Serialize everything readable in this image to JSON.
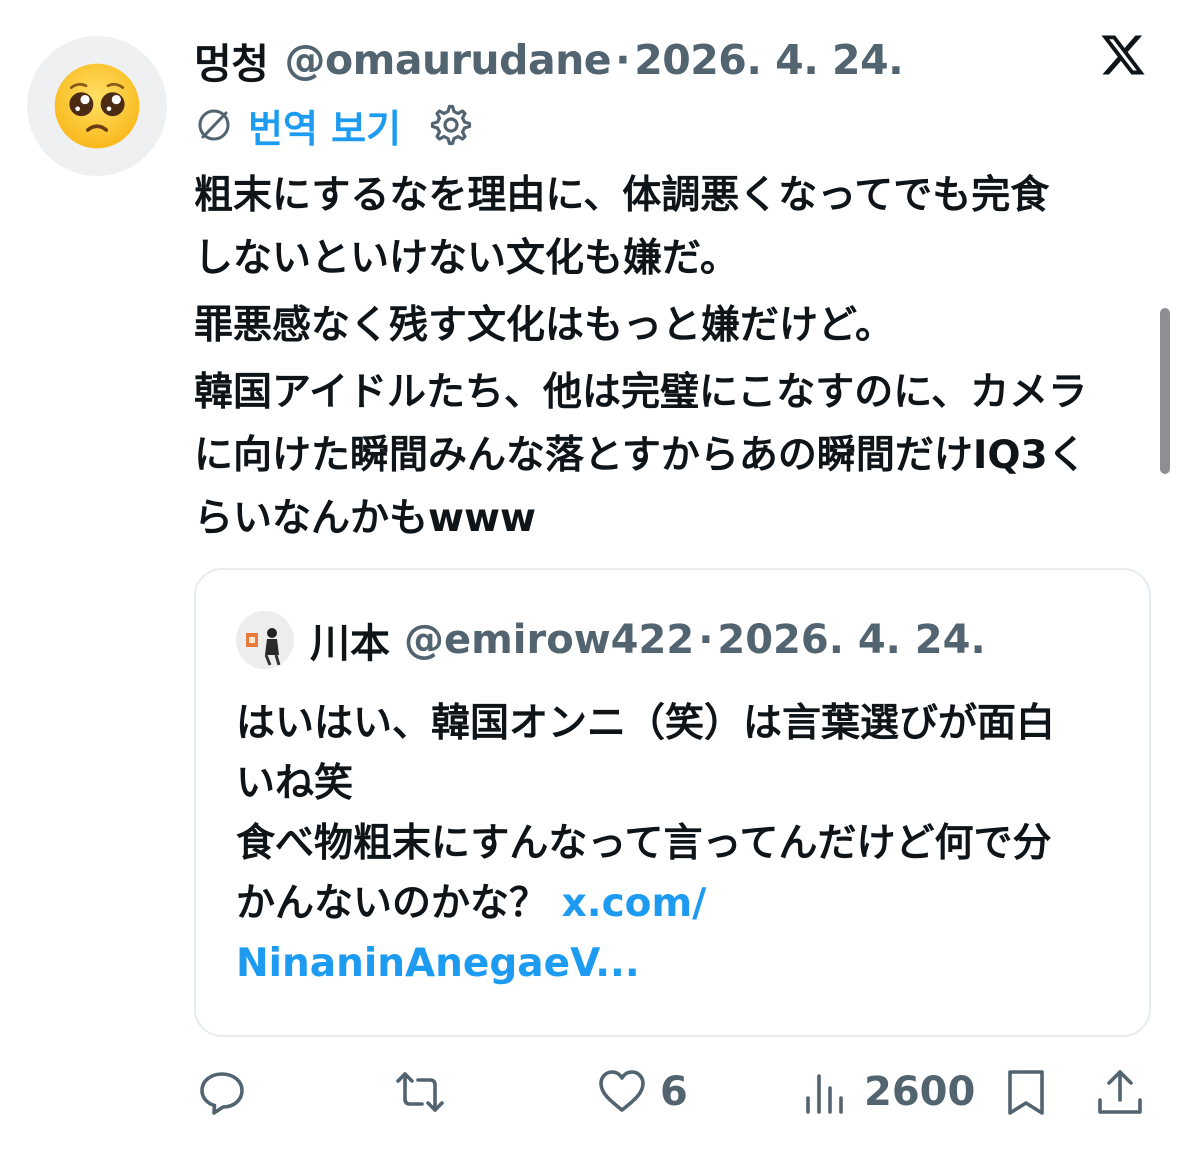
{
  "tweet": {
    "display_name": "멍청",
    "handle": "@omaurudane",
    "separator": "·",
    "date": "2026. 4. 24.",
    "translate_label": "번역 보기",
    "body_lines": [
      "粗末にするなを理由に、体調悪くなってでも完食",
      "しないといけない文化も嫌だ。",
      "罪悪感なく残す文化はもっと嫌だけど。",
      "韓国アイドルたち、他は完璧にこなすのに、カメラ",
      "に向けた瞬間みんな落とすからあの瞬間だけIQ3く",
      "らいなんかもwww"
    ]
  },
  "quote": {
    "display_name": "川本",
    "handle": "@emirow422",
    "separator": "·",
    "date": "2026. 4. 24.",
    "body_lines": [
      "はいはい、韓国オンニ（笑）は言葉選びが面白",
      "いね笑",
      "食べ物粗末にすんなって言ってんだけど何で分",
      "かんないのかな？"
    ],
    "link_part1": "x.com/",
    "link_part2": "NinaninAnegaeV..."
  },
  "actions": {
    "reply_count": "",
    "retweet_count": "",
    "like_count": "6",
    "view_count": "2600"
  },
  "icons": {
    "avatar": "pleading-face-emoji",
    "logo": "x-logo-icon",
    "translate": "globe-icon",
    "settings": "gear-icon",
    "reply": "reply-icon",
    "retweet": "retweet-icon",
    "like": "heart-icon",
    "views": "views-icon",
    "bookmark": "bookmark-icon",
    "share": "share-icon"
  },
  "colors": {
    "text_primary": "#0f1419",
    "text_secondary": "#536471",
    "accent": "#1d9bf0",
    "border": "#e6ecf0"
  }
}
